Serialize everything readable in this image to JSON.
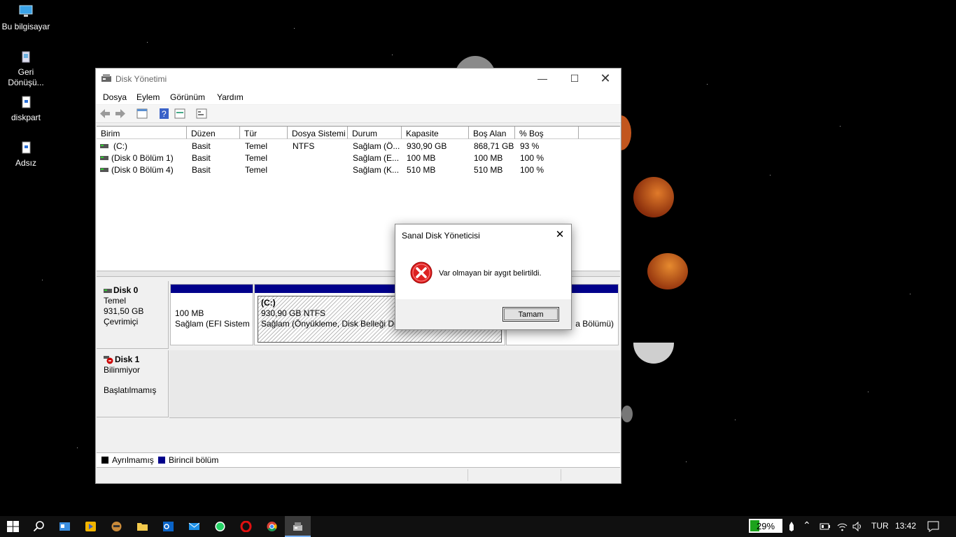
{
  "desktop": {
    "icons": [
      {
        "label": "Bu bilgisayar"
      },
      {
        "label": "Geri Dönüşü..."
      },
      {
        "label": "diskpart"
      },
      {
        "label": "Adsız"
      }
    ]
  },
  "window": {
    "title": "Disk Yönetimi",
    "menu": [
      "Dosya",
      "Eylem",
      "Görünüm",
      "Yardım"
    ],
    "columns": [
      "Birim",
      "Düzen",
      "Tür",
      "Dosya Sistemi",
      "Durum",
      "Kapasite",
      "Boş Alan",
      "% Boş"
    ],
    "rows": [
      {
        "birim": "(C:)",
        "duzen": "Basit",
        "tur": "Temel",
        "fs": "NTFS",
        "durum": "Sağlam (Ö...",
        "kapasite": "930,90 GB",
        "bos": "868,71 GB",
        "yuzde": "93 %"
      },
      {
        "birim": "(Disk 0 Bölüm 1)",
        "duzen": "Basit",
        "tur": "Temel",
        "fs": "",
        "durum": "Sağlam (E...",
        "kapasite": "100 MB",
        "bos": "100 MB",
        "yuzde": "100 %"
      },
      {
        "birim": "(Disk 0 Bölüm 4)",
        "duzen": "Basit",
        "tur": "Temel",
        "fs": "",
        "durum": "Sağlam (K...",
        "kapasite": "510 MB",
        "bos": "510 MB",
        "yuzde": "100 %"
      }
    ],
    "disks": {
      "disk0": {
        "name": "Disk 0",
        "type": "Temel",
        "size": "931,50 GB",
        "status": "Çevrimiçi"
      },
      "disk1": {
        "name": "Disk 1",
        "type": "Bilinmiyor",
        "status": "Başlatılmamış"
      }
    },
    "partitions": {
      "p1": {
        "size": "100 MB",
        "status": "Sağlam (EFI Sistem B"
      },
      "p2": {
        "label": "(C:)",
        "size": "930,90 GB NTFS",
        "status": "Sağlam (Önyükleme, Disk Belleği Dos"
      },
      "p3": {
        "status": "a Bölümü)"
      }
    },
    "legend": {
      "unallocated": "Ayrılmamış",
      "primary": "Birincil bölüm"
    },
    "colors": {
      "primary": "#00008b",
      "unallocated": "#000000"
    }
  },
  "dialog": {
    "title": "Sanal Disk Yöneticisi",
    "message": "Var olmayan bir aygıt belirtildi.",
    "ok": "Tamam",
    "icon": "error-icon"
  },
  "taskbar": {
    "battery": "29%",
    "battery_level": 0.29,
    "lang": "TUR",
    "time": "13:42",
    "apps": [
      "search-icon",
      "contacts-icon",
      "media-player-icon",
      "mascot-app-icon",
      "file-explorer-icon",
      "outlook-icon",
      "mail-icon",
      "whatsapp-icon",
      "opera-icon",
      "chrome-icon",
      "disk-management-icon"
    ]
  }
}
